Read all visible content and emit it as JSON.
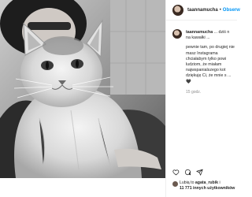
{
  "post": {
    "username": "taannamucha",
    "follow_label": "Obserw",
    "separator": "•",
    "caption_lines": [
      "... dziś n na kawałki ...",
      "pewnie tam, po drugiej nie masz Instagrama chciałabym tylko powi ludziom, że miałam najwspanialszego kot dziękuję Ci, że mnie s ..."
    ],
    "heart_glyph": "🖤",
    "time": "15 godz.",
    "likes_prefix": "Lubią to",
    "likes_user": "agata_rubik",
    "likes_suffix": "i",
    "likes_count": "11 771 innych użytkowników"
  },
  "icons": {
    "like": "heart-outline-icon",
    "comment": "comment-icon",
    "share": "share-icon"
  },
  "colors": {
    "accent": "#0095f6",
    "text": "#262626",
    "muted": "#8e8e8e"
  }
}
